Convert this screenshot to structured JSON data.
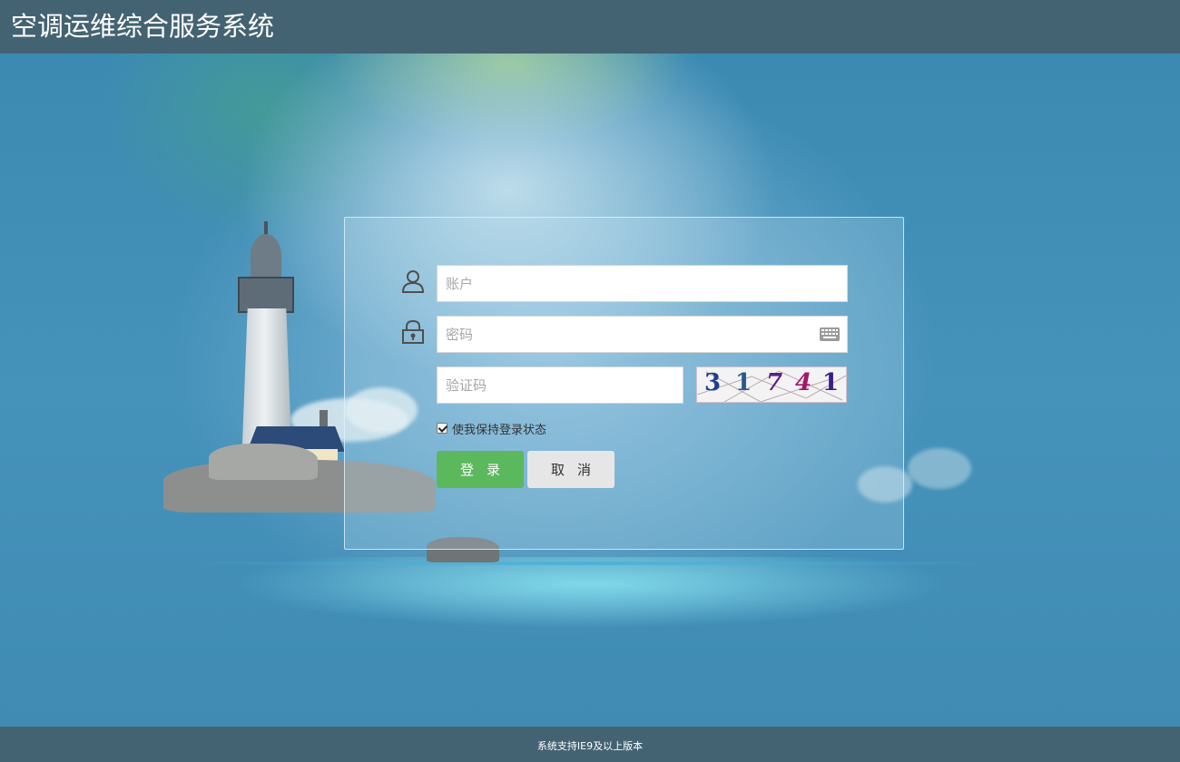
{
  "header": {
    "title": "空调运维综合服务系统"
  },
  "login": {
    "username": {
      "placeholder": "账户",
      "icon": "user-icon"
    },
    "password": {
      "placeholder": "密码",
      "icon": "lock-icon",
      "keyboard_icon": "keyboard-icon"
    },
    "captcha": {
      "placeholder": "验证码",
      "digits": [
        "3",
        "1",
        "7",
        "4",
        "1"
      ]
    },
    "remember_label": "使我保持登录状态",
    "remember_checked": true,
    "login_button": "登录",
    "cancel_button": "取消"
  },
  "footer": {
    "text": "系统支持IE9及以上版本"
  },
  "colors": {
    "header_bg": "#446372",
    "login_button": "#5cb85c",
    "cancel_button": "#e6e6e6"
  }
}
